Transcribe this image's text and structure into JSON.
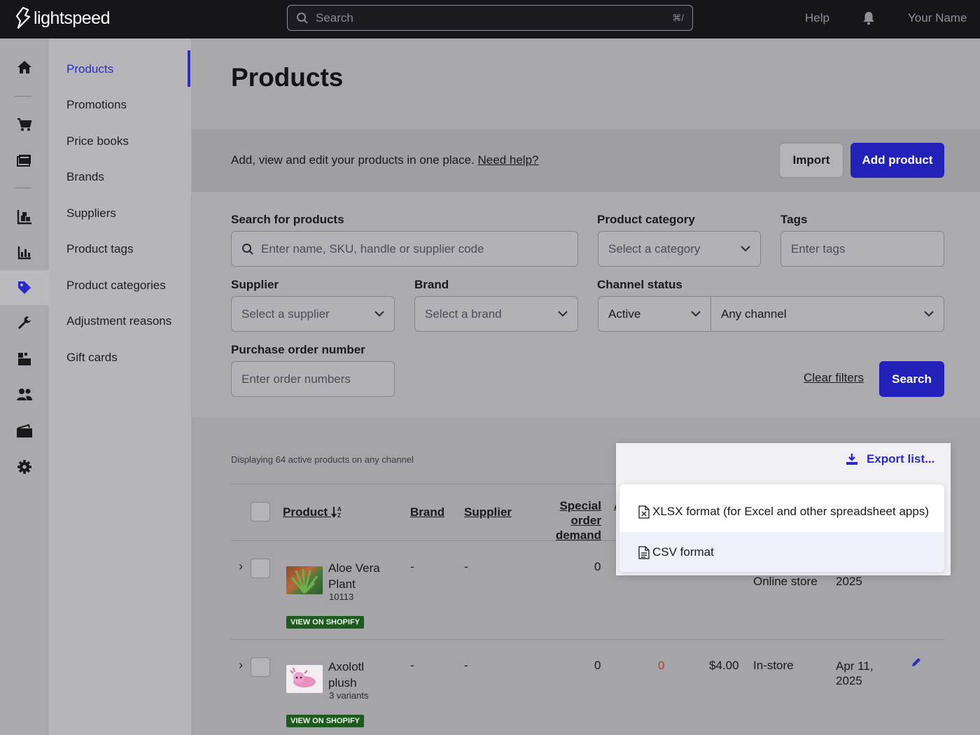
{
  "topbar": {
    "logo_text": "lightspeed",
    "search_placeholder": "Search",
    "search_shortcut": "⌘/",
    "help": "Help",
    "user": "Your Name"
  },
  "rail": [
    "home-icon",
    "cart-icon",
    "register-icon",
    "inventory-icon",
    "reports-icon",
    "tag-icon",
    "wrench-icon",
    "catalog-icon",
    "customers-icon",
    "wallet-icon",
    "gear-icon"
  ],
  "subnav": {
    "items": [
      "Products",
      "Promotions",
      "Price books",
      "Brands",
      "Suppliers",
      "Product tags",
      "Product categories",
      "Adjustment reasons",
      "Gift cards"
    ],
    "active": "Products"
  },
  "page": {
    "title": "Products",
    "banner_text": "Add, view and edit your products in one place.",
    "banner_link": "Need help?",
    "import_label": "Import",
    "add_label": "Add product"
  },
  "filters": {
    "search_label": "Search for products",
    "search_placeholder": "Enter name, SKU, handle or supplier code",
    "category_label": "Product category",
    "category_value": "Select a category",
    "tags_label": "Tags",
    "tags_placeholder": "Enter tags",
    "supplier_label": "Supplier",
    "supplier_value": "Select a supplier",
    "brand_label": "Brand",
    "brand_value": "Select a brand",
    "channel_label": "Channel status",
    "status_value": "Active",
    "channel_value": "Any channel",
    "po_label": "Purchase order number",
    "po_placeholder": "Enter order numbers",
    "clear_label": "Clear filters",
    "search_button": "Search"
  },
  "results": {
    "displaying": "Displaying 64 active products on any channel",
    "columns": {
      "product": "Product",
      "brand": "Brand",
      "supplier": "Supplier",
      "special_order_1": "Special order",
      "special_order_2": "demand",
      "partial": "A"
    },
    "rows": [
      {
        "name_1": "Aloe Vera",
        "name_2": "Plant",
        "sub": "10113",
        "brand": "-",
        "supplier": "-",
        "special": "0",
        "channel": "Online store",
        "date_2": "2025",
        "badge": "VIEW ON SHOPIFY"
      },
      {
        "name_1": "Axolotl",
        "name_2": "plush",
        "sub": "3 variants",
        "brand": "-",
        "supplier": "-",
        "special": "0",
        "onhand": "0",
        "price": "$4.00",
        "channel": "In-store",
        "date_1": "Apr 11,",
        "date_2": "2025",
        "badge": "VIEW ON SHOPIFY"
      }
    ]
  },
  "export": {
    "button": "Export list...",
    "options": [
      "XLSX format (for Excel and other spreadsheet apps)",
      "CSV format"
    ]
  },
  "colors": {
    "primary": "#2222bb",
    "link": "#2a2acc",
    "topbar": "#16161a",
    "badge": "#1d5a1d",
    "negative": "#c0392b"
  }
}
